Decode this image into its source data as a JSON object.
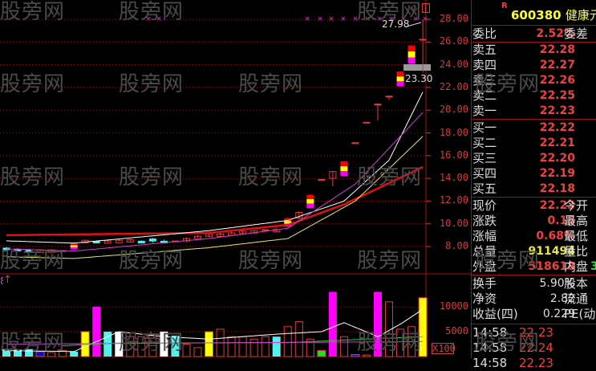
{
  "watermark": "股旁网",
  "header": {
    "flag": "R",
    "code": "600380",
    "name": "健康元"
  },
  "weibi": {
    "label": "委比",
    "value": "2.52%",
    "label2": "委差"
  },
  "sell": [
    {
      "label": "卖五",
      "price": "22.28"
    },
    {
      "label": "卖四",
      "price": "22.27"
    },
    {
      "label": "卖三",
      "price": "22.26"
    },
    {
      "label": "卖二",
      "price": "22.25"
    },
    {
      "label": "卖一",
      "price": "22.23"
    }
  ],
  "buy": [
    {
      "label": "买一",
      "price": "22.22"
    },
    {
      "label": "买二",
      "price": "22.21"
    },
    {
      "label": "买三",
      "price": "22.20"
    },
    {
      "label": "买四",
      "price": "22.19"
    },
    {
      "label": "买五",
      "price": "22.18"
    }
  ],
  "quote": [
    {
      "label": "现价",
      "value": "22.23",
      "color": "red",
      "label2": "今开"
    },
    {
      "label": "涨跌",
      "value": "0.15",
      "color": "red",
      "label2": "最高"
    },
    {
      "label": "涨幅",
      "value": "0.68%",
      "color": "red",
      "label2": "最低"
    },
    {
      "label": "总量",
      "value": "911494",
      "color": "yel",
      "label2": "量比"
    },
    {
      "label": "外盘",
      "value": "518618",
      "color": "red",
      "label2": "内盘",
      "extra": "3"
    }
  ],
  "stats": [
    {
      "label": "换手",
      "value": "5.90%",
      "label2": "股本"
    },
    {
      "label": "净资",
      "value": "2.82",
      "label2": "流通"
    },
    {
      "label": "收益(四)",
      "value": "0.229",
      "label2": "PE(动)"
    }
  ],
  "ticks": [
    {
      "time": "14:58",
      "price": "22.23"
    },
    {
      "time": "14:58",
      "price": "22.24"
    },
    {
      "time": "14:58",
      "price": "22.23"
    }
  ],
  "price_axis": [
    "28.00",
    "26.00",
    "24.00",
    "22.00",
    "20.00",
    "18.00",
    "16.00",
    "14.00",
    "12.00",
    "10.00",
    "8.00"
  ],
  "volume_axis": {
    "labels": [
      "10000",
      "5000"
    ],
    "unit": "X100"
  },
  "annotations": {
    "high_label": "27.98",
    "low_label": "23.30",
    "volume_indicator": "8"
  },
  "colors": {
    "up": "#e03c3c",
    "down": "#54f0f0",
    "limit_top": "#ff0000",
    "limit_mid": "#ffff00",
    "limit_bot": "#ff00ff",
    "ma_red": "#e01010",
    "ma_white": "#ffffff",
    "ma_magenta": "#d040d0",
    "ma_yellow": "#e8e860"
  },
  "chart_data": {
    "type": "candlestick",
    "price_range": [
      7,
      28.6
    ],
    "candles": [
      [
        7.9,
        7.95,
        7.75,
        7.8,
        "down"
      ],
      [
        7.8,
        7.85,
        7.7,
        7.75,
        "down"
      ],
      [
        7.75,
        7.8,
        7.65,
        7.7,
        "down"
      ],
      [
        7.65,
        7.75,
        7.55,
        7.7,
        "up"
      ],
      [
        7.65,
        7.75,
        7.6,
        7.7,
        "up"
      ],
      [
        7.6,
        7.7,
        7.55,
        7.55,
        "flat"
      ],
      [
        7.75,
        8.35,
        7.7,
        8.3,
        "limit"
      ],
      [
        8.35,
        8.6,
        8.3,
        8.55,
        "up"
      ],
      [
        8.5,
        8.55,
        8.4,
        8.45,
        "down"
      ],
      [
        8.45,
        8.55,
        8.35,
        8.5,
        "up"
      ],
      [
        8.55,
        8.65,
        8.45,
        8.5,
        "up"
      ],
      [
        8.6,
        8.7,
        8.45,
        8.45,
        "up"
      ],
      [
        8.5,
        8.55,
        8.4,
        8.45,
        "down"
      ],
      [
        8.7,
        8.75,
        8.35,
        8.45,
        "down"
      ],
      [
        8.5,
        8.6,
        8.45,
        8.45,
        "down"
      ],
      [
        8.45,
        8.5,
        8.4,
        8.45,
        "flat"
      ],
      [
        8.5,
        8.8,
        8.4,
        8.7,
        "up"
      ],
      [
        8.85,
        9.0,
        8.8,
        8.9,
        "up"
      ],
      [
        8.9,
        9.3,
        8.85,
        9.25,
        "up"
      ],
      [
        9.1,
        9.2,
        9.0,
        9.1,
        "up"
      ],
      [
        9.2,
        9.35,
        9.1,
        9.2,
        "up"
      ],
      [
        9.2,
        9.4,
        9.15,
        9.35,
        "up"
      ],
      [
        9.3,
        9.45,
        9.25,
        9.4,
        "up"
      ],
      [
        9.4,
        9.5,
        9.3,
        9.45,
        "flat"
      ],
      [
        9.3,
        9.6,
        9.25,
        9.5,
        "up"
      ],
      [
        9.75,
        10.55,
        9.7,
        10.5,
        "limit"
      ],
      [
        10.5,
        11.1,
        10.4,
        11.0,
        "up"
      ],
      [
        11.4,
        12.6,
        11.35,
        12.55,
        "limit"
      ],
      [
        13.85,
        13.9,
        13.8,
        13.87,
        "flat"
      ],
      [
        14.0,
        14.6,
        13.3,
        14.6,
        "up"
      ],
      [
        14.2,
        15.5,
        14.2,
        15.5,
        "limit"
      ],
      [
        17.1,
        17.15,
        17.05,
        17.1,
        "flat"
      ],
      [
        18.9,
        18.95,
        18.85,
        18.9,
        "flat"
      ],
      [
        20.5,
        20.6,
        19.1,
        20.5,
        "flat"
      ],
      [
        21.1,
        21.3,
        20.9,
        21.2,
        "flat"
      ],
      [
        22.1,
        23.4,
        22.1,
        23.4,
        "limit"
      ],
      [
        24.1,
        25.7,
        24.1,
        25.7,
        "limit"
      ],
      [
        26.2,
        27.98,
        23.3,
        26.2,
        "flat"
      ]
    ],
    "ma_lines": [
      {
        "name": "MA-red",
        "color": "#e01010",
        "points": [
          [
            0,
            9.0
          ],
          [
            18,
            9.2
          ],
          [
            25,
            9.9
          ],
          [
            30,
            11.7
          ],
          [
            37,
            15.0
          ]
        ]
      },
      {
        "name": "MA-white",
        "color": "#ffffff",
        "points": [
          [
            0,
            8.5
          ],
          [
            6,
            8.3
          ],
          [
            18,
            9.4
          ],
          [
            25,
            10.3
          ],
          [
            30,
            12.0
          ],
          [
            34,
            15.6
          ],
          [
            37,
            21.6
          ]
        ]
      },
      {
        "name": "MA-magenta",
        "color": "#d040d0",
        "points": [
          [
            0,
            7.8
          ],
          [
            6,
            7.6
          ],
          [
            18,
            8.7
          ],
          [
            25,
            9.6
          ],
          [
            31,
            13.5
          ],
          [
            37,
            19.8
          ]
        ]
      },
      {
        "name": "MA-yellow",
        "color": "#e8e860",
        "points": [
          [
            0,
            7.1
          ],
          [
            6,
            6.95
          ],
          [
            18,
            7.9
          ],
          [
            25,
            8.7
          ],
          [
            31,
            12.0
          ],
          [
            37,
            17.7
          ]
        ]
      }
    ],
    "volumes": [
      [
        1500,
        "down"
      ],
      [
        1400,
        "down"
      ],
      [
        1500,
        "down"
      ],
      [
        1000,
        "blue"
      ],
      [
        800,
        "up"
      ],
      [
        1200,
        "up"
      ],
      [
        1000,
        "down"
      ],
      [
        5000,
        "yellow"
      ],
      [
        10000,
        "magenta"
      ],
      [
        5000,
        "down"
      ],
      [
        5000,
        "white"
      ],
      [
        4000,
        "up"
      ],
      [
        4000,
        "up"
      ],
      [
        4200,
        "up"
      ],
      [
        5000,
        "white"
      ],
      [
        4200,
        "down"
      ],
      [
        2500,
        "up"
      ],
      [
        1800,
        "up"
      ],
      [
        5000,
        "yellow"
      ],
      [
        5500,
        "up"
      ],
      [
        4000,
        "up"
      ],
      [
        4000,
        "up"
      ],
      [
        3500,
        "up"
      ],
      [
        4000,
        "up"
      ],
      [
        4000,
        "down"
      ],
      [
        6000,
        "up"
      ],
      [
        7000,
        "up"
      ],
      [
        3500,
        "up"
      ],
      [
        1200,
        "green"
      ],
      [
        13000,
        "magenta"
      ],
      [
        4000,
        "up"
      ],
      [
        400,
        "blue"
      ],
      [
        300,
        "up"
      ],
      [
        13000,
        "magenta"
      ],
      [
        11000,
        "up"
      ],
      [
        5500,
        "up"
      ],
      [
        6000,
        "up"
      ],
      [
        11800,
        "yellow"
      ]
    ],
    "volume_ma": [
      {
        "name": "VMA-white",
        "color": "#ffffff",
        "points": [
          [
            0,
            1200
          ],
          [
            6,
            1000
          ],
          [
            10,
            5000
          ],
          [
            14,
            4000
          ],
          [
            18,
            3500
          ],
          [
            24,
            4500
          ],
          [
            28,
            5000
          ],
          [
            30,
            6800
          ],
          [
            33,
            4000
          ],
          [
            35,
            6500
          ],
          [
            37,
            9500
          ]
        ]
      },
      {
        "name": "VMA-green",
        "color": "#30d030",
        "points": [
          [
            5,
            2200
          ],
          [
            10,
            2700
          ],
          [
            25,
            2800
          ],
          [
            37,
            4000
          ]
        ]
      },
      {
        "name": "VMA-magenta",
        "color": "#d040d0",
        "points": [
          [
            0,
            2500
          ],
          [
            37,
            3000
          ]
        ]
      }
    ]
  }
}
